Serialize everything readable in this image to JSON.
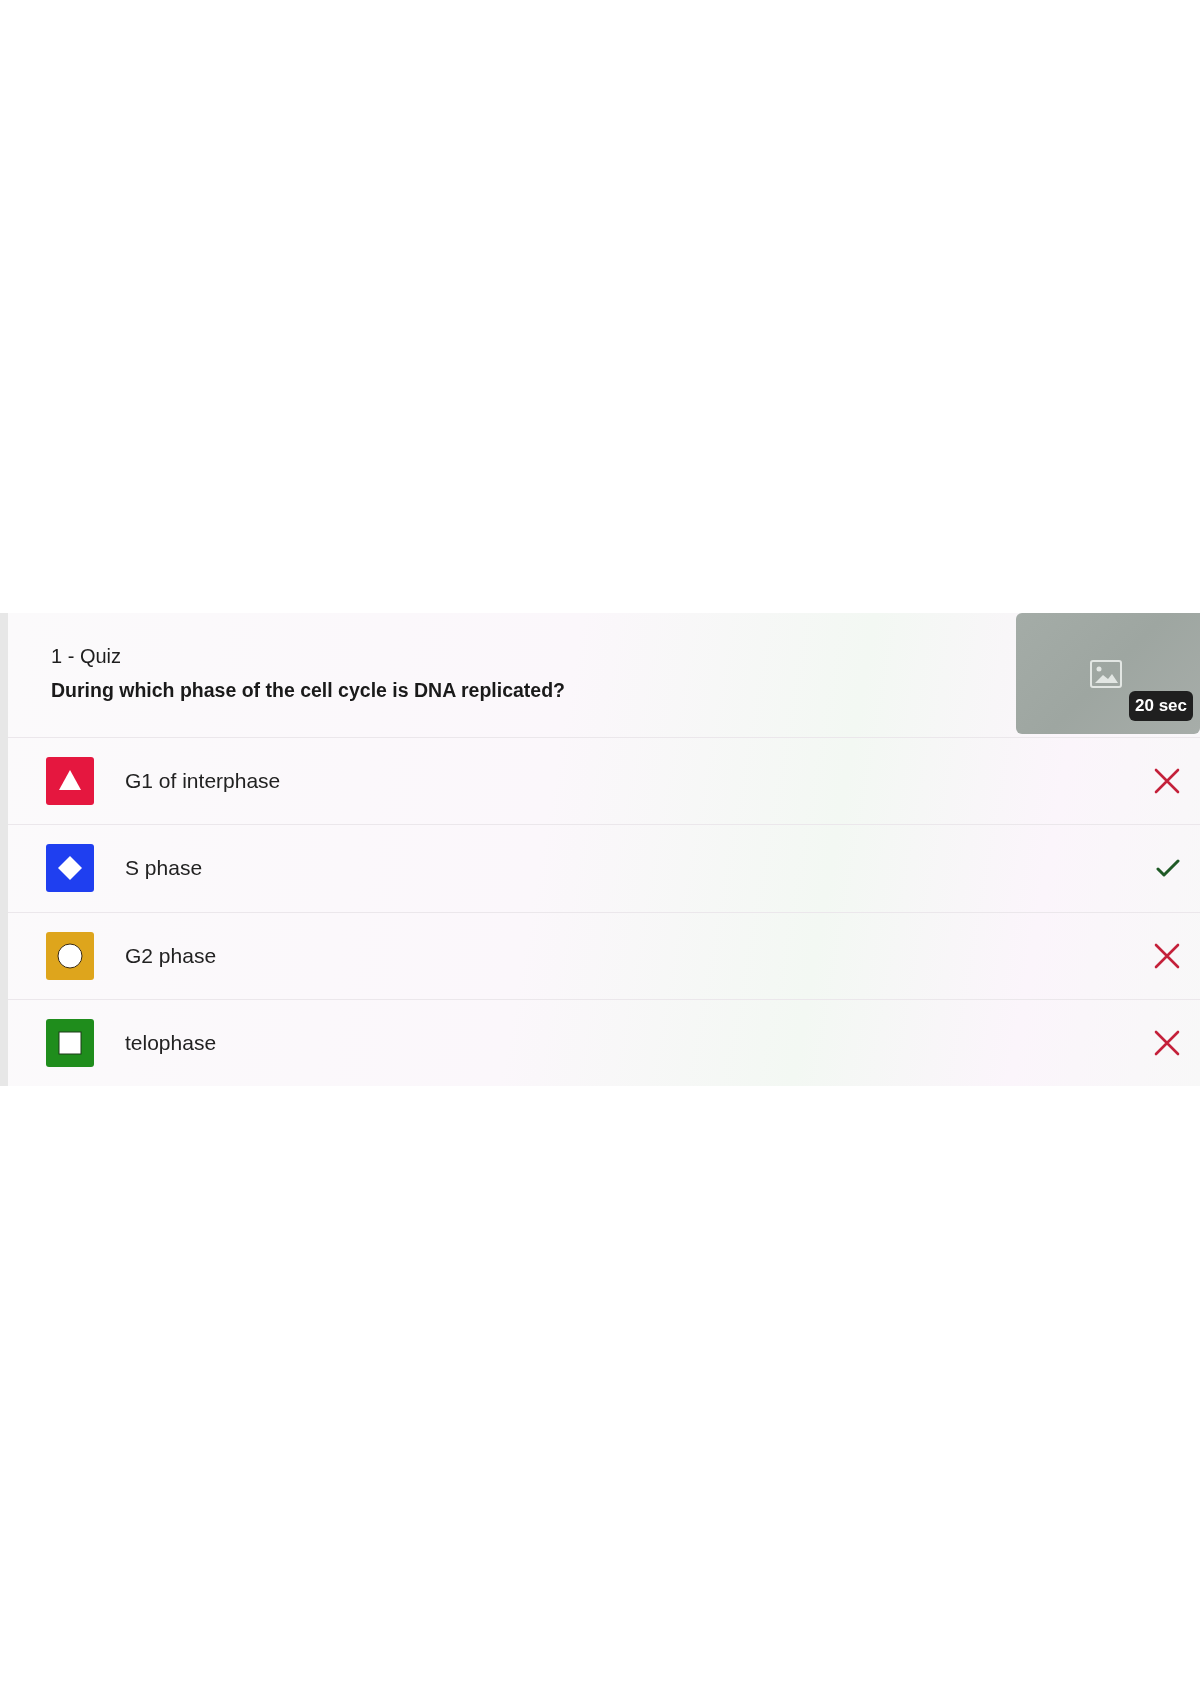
{
  "quiz": {
    "label": "1 - Quiz",
    "question": "During which phase of the cell cycle is DNA replicated?",
    "media": {
      "timer": "20 sec"
    }
  },
  "answers": [
    {
      "text": "G1 of interphase",
      "kind": "triangle",
      "color": "#e5173f",
      "correct": false
    },
    {
      "text": "S phase",
      "kind": "diamond",
      "color": "#1f3ff0",
      "correct": true
    },
    {
      "text": "G2 phase",
      "kind": "circle",
      "color": "#dea51c",
      "correct": false
    },
    {
      "text": "telophase",
      "kind": "square",
      "color": "#1f8d1c",
      "correct": false
    }
  ]
}
